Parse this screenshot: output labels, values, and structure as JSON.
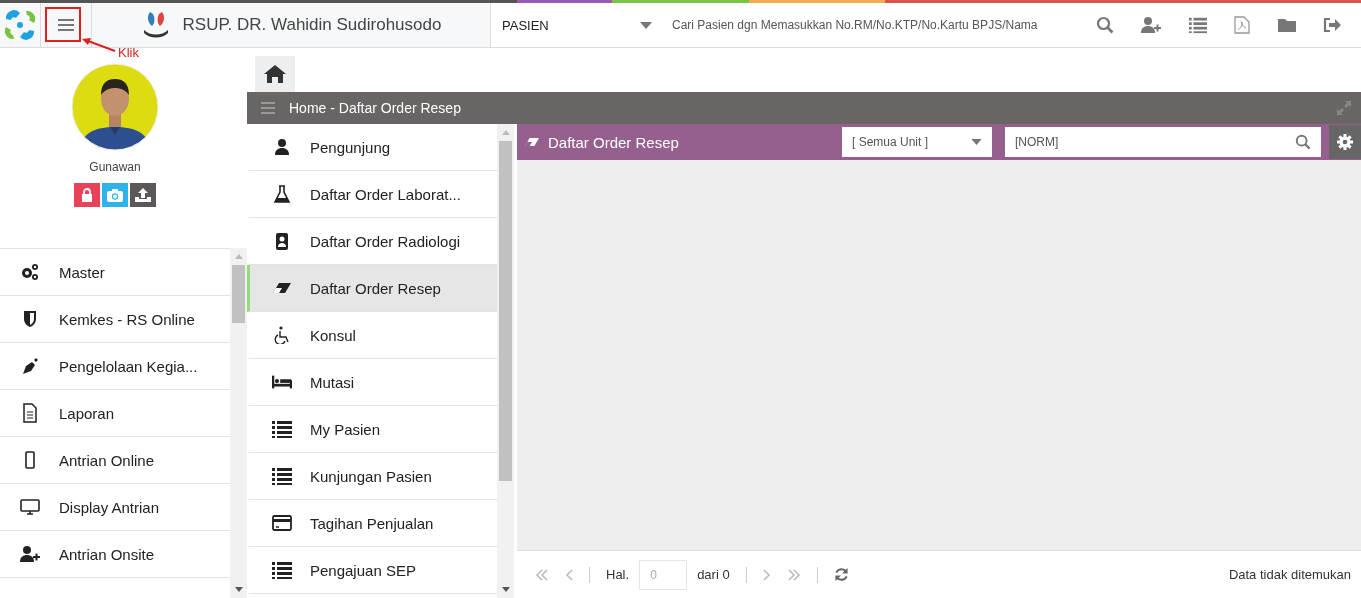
{
  "header": {
    "title": "RSUP. DR. Wahidin Sudirohusodo",
    "category": "PASIEN",
    "search": {
      "placeholder": "Cari Pasien dgn Memasukkan No.RM/No.KTP/No.Kartu BPJS/Nama"
    }
  },
  "annotation": {
    "label": "Klik"
  },
  "profile": {
    "name": "Gunawan"
  },
  "sidebar": {
    "items": [
      {
        "label": "Master"
      },
      {
        "label": "Kemkes - RS Online"
      },
      {
        "label": "Pengelolaan Kegia..."
      },
      {
        "label": "Laporan"
      },
      {
        "label": "Antrian Online"
      },
      {
        "label": "Display Antrian"
      },
      {
        "label": "Antrian Onsite"
      }
    ]
  },
  "breadcrumb": "Home - Daftar Order Resep",
  "submenu": {
    "items": [
      {
        "label": "Pengunjung",
        "selected": false
      },
      {
        "label": "Daftar Order Laborat...",
        "selected": false
      },
      {
        "label": "Daftar Order Radiologi",
        "selected": false
      },
      {
        "label": "Daftar Order Resep",
        "selected": true
      },
      {
        "label": "Konsul",
        "selected": false
      },
      {
        "label": "Mutasi",
        "selected": false
      },
      {
        "label": "My Pasien",
        "selected": false
      },
      {
        "label": "Kunjungan Pasien",
        "selected": false
      },
      {
        "label": "Tagihan Penjualan",
        "selected": false
      },
      {
        "label": "Pengajuan SEP",
        "selected": false
      }
    ]
  },
  "panel": {
    "title": "Daftar Order Resep",
    "unit_filter": "[ Semua Unit ]",
    "search": {
      "value": "[NORM]"
    }
  },
  "pager": {
    "page_label": "Hal.",
    "page": {
      "placeholder": "0"
    },
    "of_label": "dari 0",
    "status": "Data tidak ditemukan"
  }
}
